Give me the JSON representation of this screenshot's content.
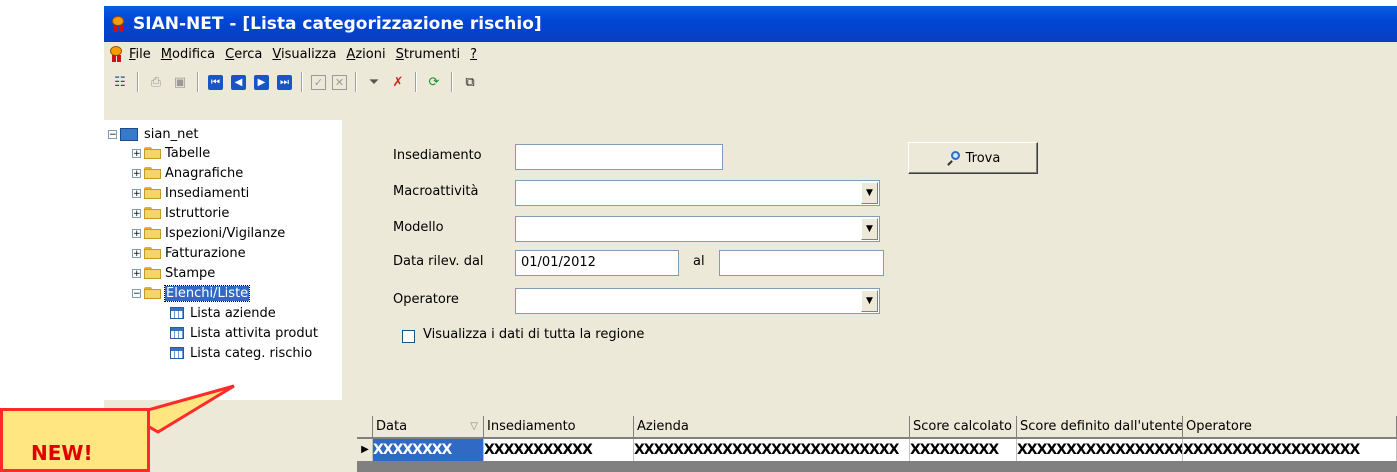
{
  "window": {
    "title": "SIAN-NET - [Lista categorizzazione rischio]"
  },
  "menu": {
    "items": [
      {
        "label": "File",
        "key": "F",
        "rest": "ile"
      },
      {
        "label": "Modifica",
        "key": "M",
        "rest": "odifica"
      },
      {
        "label": "Cerca",
        "key": "C",
        "rest": "erca"
      },
      {
        "label": "Visualizza",
        "key": "V",
        "rest": "isualizza"
      },
      {
        "label": "Azioni",
        "key": "A",
        "rest": "zioni"
      },
      {
        "label": "Strumenti",
        "key": "S",
        "rest": "trumenti"
      },
      {
        "label": "?",
        "key": "?",
        "rest": ""
      }
    ]
  },
  "toolbar": {
    "icons": [
      "tree-toggle-icon",
      "print-icon",
      "print-preview-icon",
      "first-record-icon",
      "previous-record-icon",
      "next-record-icon",
      "last-record-icon",
      "confirm-icon",
      "cancel-icon",
      "filter-icon",
      "remove-filter-icon",
      "refresh-icon",
      "export-icon"
    ],
    "nav_glyphs": {
      "first": "⏮",
      "prev": "◀",
      "next": "▶",
      "last": "⏭"
    }
  },
  "tree": {
    "root": "sian_net",
    "folders": [
      "Tabelle",
      "Anagrafiche",
      "Insediamenti",
      "Istruttorie",
      "Ispezioni/Vigilanze",
      "Fatturazione",
      "Stampe",
      "Elenchi/Liste"
    ],
    "leaves": [
      "Lista aziende",
      "Lista attivita produt",
      "Lista categ. rischio"
    ]
  },
  "form": {
    "insediamento_label": "Insediamento",
    "insediamento_value": "",
    "macroattivita_label": "Macroattività",
    "macroattivita_value": "",
    "modello_label": "Modello",
    "modello_value": "",
    "data_dal_label": "Data rilev. dal",
    "data_dal_value": "01/01/2012",
    "data_al_label": "al",
    "data_al_value": "",
    "operatore_label": "Operatore",
    "operatore_value": "",
    "checkbox_label": "Visualizza i dati di tutta la regione",
    "checkbox_checked": false,
    "find_button": "Trova"
  },
  "grid": {
    "columns": [
      "Data",
      "Insediamento",
      "Azienda",
      "Score calcolato",
      "Score definito dall'utente",
      "Operatore"
    ],
    "row": [
      "XXXXXXXX",
      "XXXXXXXXXXX",
      "XXXXXXXXXXXXXXXXXXXXXXXXXXX",
      "XXXXXXXXX",
      "XXXXXXXXXXXXXXXXXX",
      "XXXXXXXXXXXXXXXXXX"
    ]
  },
  "callout": {
    "text": "NEW!"
  }
}
